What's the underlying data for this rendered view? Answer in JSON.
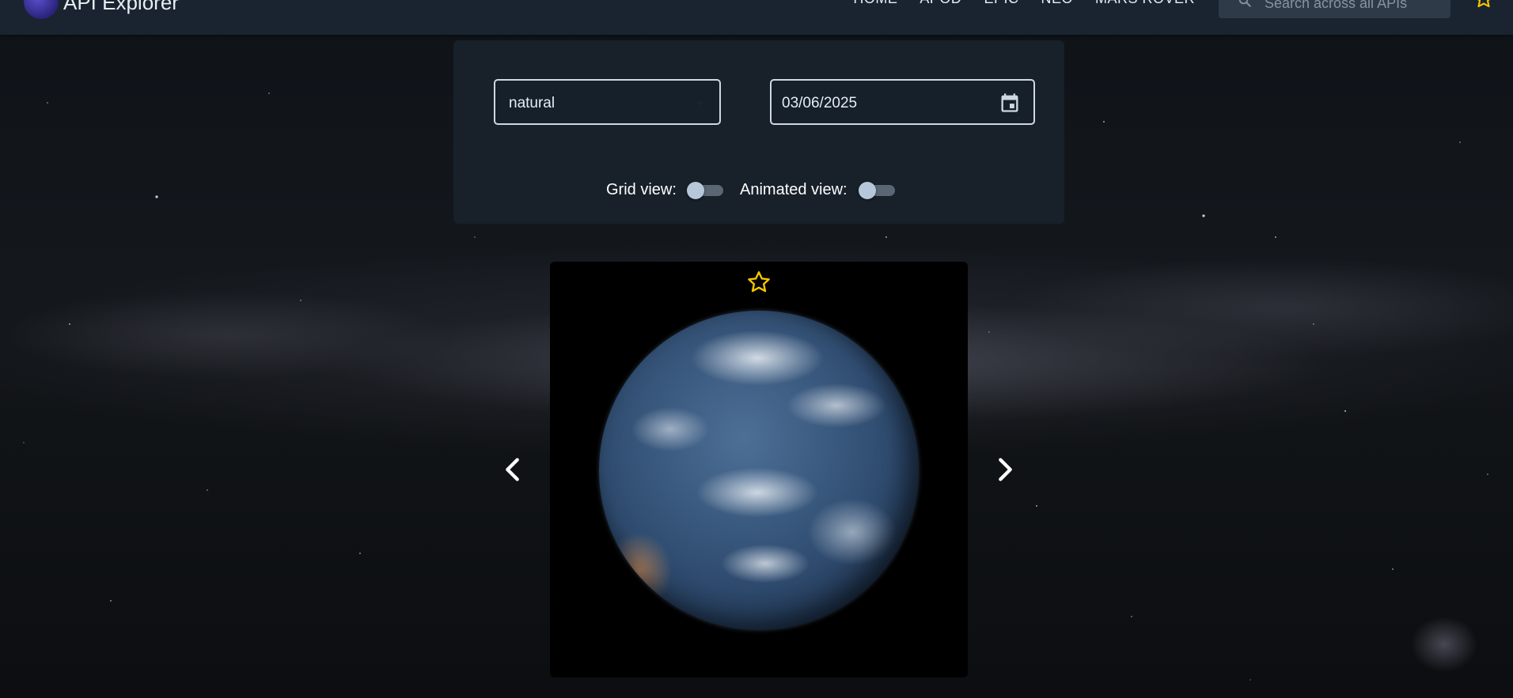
{
  "navbar": {
    "app_name": "API Explorer",
    "links": [
      "HOME",
      "APOD",
      "EPIC",
      "NEO",
      "MARS ROVER"
    ],
    "search_placeholder": "Search across all APIs",
    "logo_icon": "nasa-logo",
    "search_icon": "search-icon",
    "favorites_icon": "star-outline-icon"
  },
  "controls": {
    "image_type": "natural",
    "date": "03/06/2025",
    "calendar_icon": "calendar-icon",
    "grid_view_label": "Grid view:",
    "grid_view_on": false,
    "animated_view_label": "Animated view:",
    "animated_view_on": false
  },
  "viewer": {
    "favorite_icon": "star-outline-icon",
    "image_description": "earth-full-disc",
    "prev_icon": "chevron-left-icon",
    "next_icon": "chevron-right-icon"
  },
  "colors": {
    "navbar_bg": "#1a2430",
    "panel_bg": "#18212b",
    "accent_star": "#f5c400",
    "toggle_knob": "#b7c7da"
  }
}
